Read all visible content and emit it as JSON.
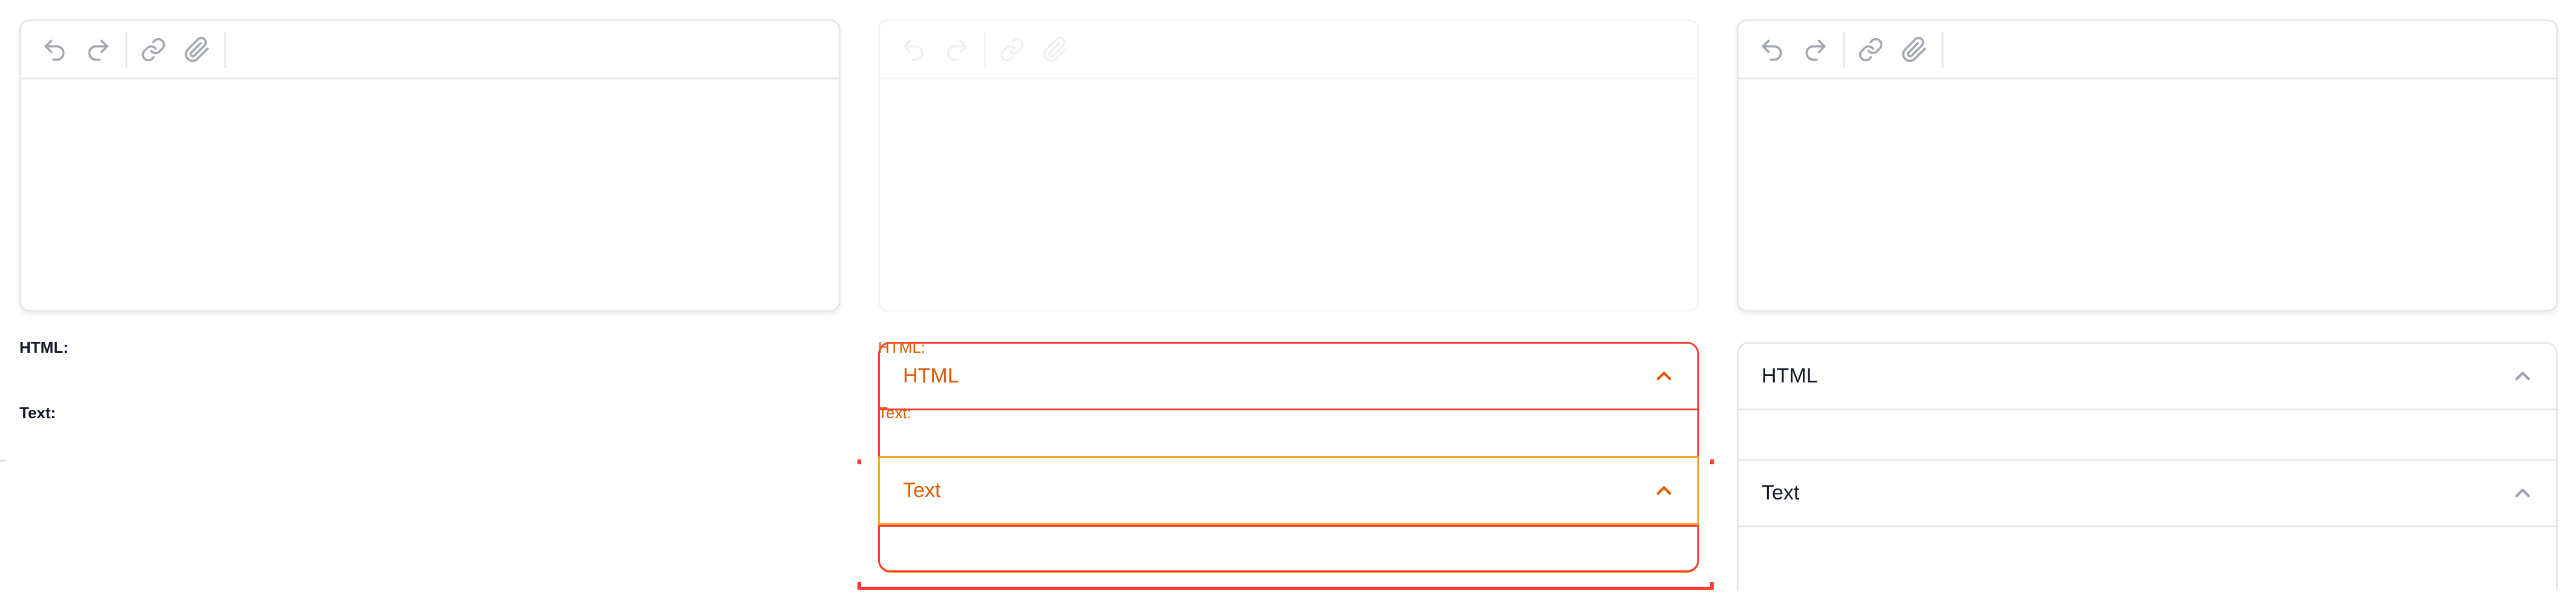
{
  "editors": {
    "icons": [
      "undo-icon",
      "redo-icon",
      "link-icon",
      "paperclip-icon"
    ]
  },
  "labels": {
    "html": "HTML:",
    "text": "Text:"
  },
  "sections": {
    "html_title": "HTML",
    "text_title": "Text"
  },
  "colors": {
    "border": "#e5e7eb",
    "icon": "#a3a8b3",
    "debug_red": "#ff3b30",
    "debug_orange": "#f5a623",
    "debug_text": "#e05a00"
  }
}
